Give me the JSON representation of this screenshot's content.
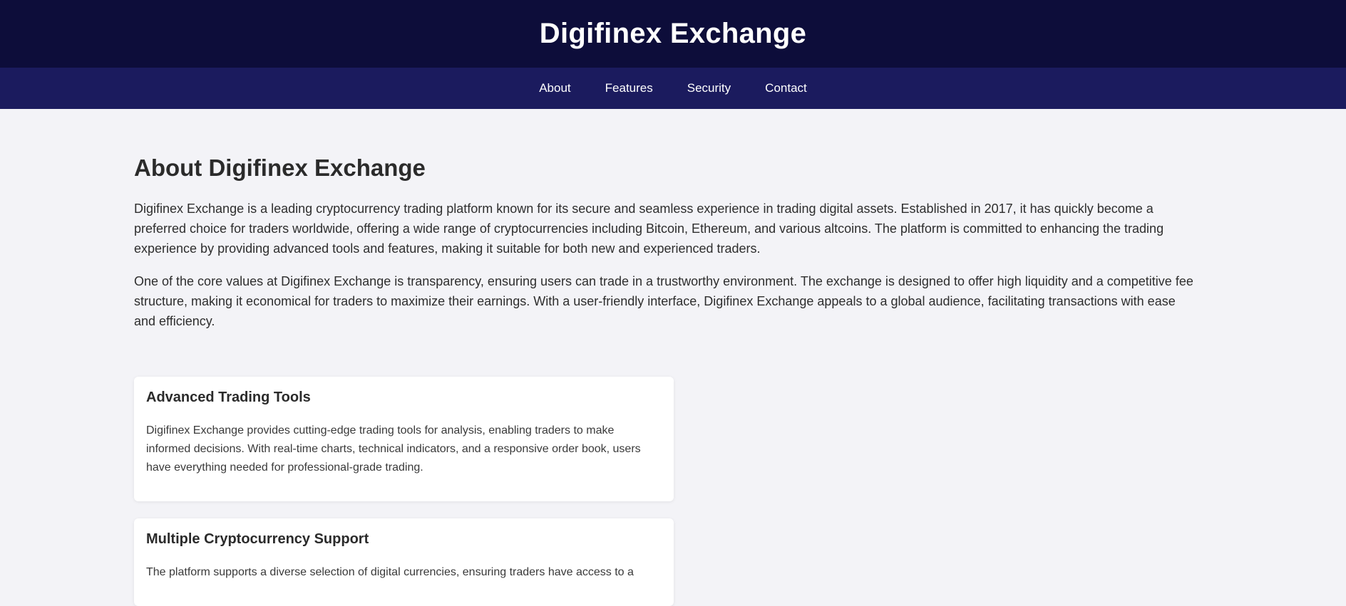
{
  "header": {
    "title": "Digifinex Exchange"
  },
  "nav": {
    "items": [
      {
        "label": "About"
      },
      {
        "label": "Features"
      },
      {
        "label": "Security"
      },
      {
        "label": "Contact"
      }
    ]
  },
  "about": {
    "heading": "About Digifinex Exchange",
    "paragraphs": [
      "Digifinex Exchange is a leading cryptocurrency trading platform known for its secure and seamless experience in trading digital assets. Established in 2017, it has quickly become a preferred choice for traders worldwide, offering a wide range of cryptocurrencies including Bitcoin, Ethereum, and various altcoins. The platform is committed to enhancing the trading experience by providing advanced tools and features, making it suitable for both new and experienced traders.",
      "One of the core values at Digifinex Exchange is transparency, ensuring users can trade in a trustworthy environment. The exchange is designed to offer high liquidity and a competitive fee structure, making it economical for traders to maximize their earnings. With a user-friendly interface, Digifinex Exchange appeals to a global audience, facilitating transactions with ease and efficiency."
    ]
  },
  "features": [
    {
      "title": "Advanced Trading Tools",
      "text": "Digifinex Exchange provides cutting-edge trading tools for analysis, enabling traders to make informed decisions. With real-time charts, technical indicators, and a responsive order book, users have everything needed for professional-grade trading."
    },
    {
      "title": "Multiple Cryptocurrency Support",
      "text": "The platform supports a diverse selection of digital currencies, ensuring traders have access to a"
    }
  ]
}
